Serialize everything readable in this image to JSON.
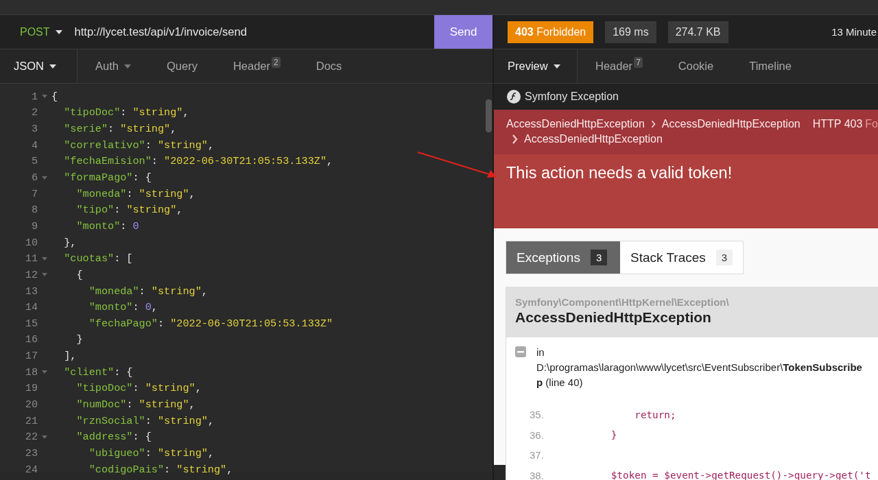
{
  "request": {
    "method": "POST",
    "url": "http://lycet.test/api/v1/invoice/send",
    "send_label": "Send"
  },
  "request_tabs": [
    {
      "label": "JSON",
      "dropdown": true,
      "selected": true
    },
    {
      "label": "Auth",
      "dropdown": true,
      "selected": false
    },
    {
      "label": "Query",
      "dropdown": false,
      "selected": false
    },
    {
      "label": "Header",
      "count": "2",
      "dropdown": false,
      "selected": false
    },
    {
      "label": "Docs",
      "dropdown": false,
      "selected": false
    }
  ],
  "editor": {
    "lines": [
      {
        "number": "1",
        "foldable": true,
        "tokens": [
          {
            "kind": "punct",
            "text": "{"
          }
        ]
      },
      {
        "number": "2",
        "foldable": false,
        "tokens": [
          {
            "kind": "key",
            "text": "  \"tipoDoc\""
          },
          {
            "kind": "punct",
            "text": ": "
          },
          {
            "kind": "str",
            "text": "\"string\""
          },
          {
            "kind": "punct",
            "text": ","
          }
        ]
      },
      {
        "number": "3",
        "foldable": false,
        "tokens": [
          {
            "kind": "key",
            "text": "  \"serie\""
          },
          {
            "kind": "punct",
            "text": ": "
          },
          {
            "kind": "str",
            "text": "\"string\""
          },
          {
            "kind": "punct",
            "text": ","
          }
        ]
      },
      {
        "number": "4",
        "foldable": false,
        "tokens": [
          {
            "kind": "key",
            "text": "  \"correlativo\""
          },
          {
            "kind": "punct",
            "text": ": "
          },
          {
            "kind": "str",
            "text": "\"string\""
          },
          {
            "kind": "punct",
            "text": ","
          }
        ]
      },
      {
        "number": "5",
        "foldable": false,
        "tokens": [
          {
            "kind": "key",
            "text": "  \"fechaEmision\""
          },
          {
            "kind": "punct",
            "text": ": "
          },
          {
            "kind": "str",
            "text": "\"2022-06-30T21:05:53.133Z\""
          },
          {
            "kind": "punct",
            "text": ","
          }
        ]
      },
      {
        "number": "6",
        "foldable": true,
        "tokens": [
          {
            "kind": "key",
            "text": "  \"formaPago\""
          },
          {
            "kind": "punct",
            "text": ": {"
          }
        ]
      },
      {
        "number": "7",
        "foldable": false,
        "tokens": [
          {
            "kind": "key",
            "text": "    \"moneda\""
          },
          {
            "kind": "punct",
            "text": ": "
          },
          {
            "kind": "str",
            "text": "\"string\""
          },
          {
            "kind": "punct",
            "text": ","
          }
        ]
      },
      {
        "number": "8",
        "foldable": false,
        "tokens": [
          {
            "kind": "key",
            "text": "    \"tipo\""
          },
          {
            "kind": "punct",
            "text": ": "
          },
          {
            "kind": "str",
            "text": "\"string\""
          },
          {
            "kind": "punct",
            "text": ","
          }
        ]
      },
      {
        "number": "9",
        "foldable": false,
        "tokens": [
          {
            "kind": "key",
            "text": "    \"monto\""
          },
          {
            "kind": "punct",
            "text": ": "
          },
          {
            "kind": "num",
            "text": "0"
          }
        ]
      },
      {
        "number": "10",
        "foldable": false,
        "tokens": [
          {
            "kind": "punct",
            "text": "  },"
          }
        ]
      },
      {
        "number": "11",
        "foldable": true,
        "tokens": [
          {
            "kind": "key",
            "text": "  \"cuotas\""
          },
          {
            "kind": "punct",
            "text": ": ["
          }
        ]
      },
      {
        "number": "12",
        "foldable": true,
        "tokens": [
          {
            "kind": "punct",
            "text": "    {"
          }
        ]
      },
      {
        "number": "13",
        "foldable": false,
        "tokens": [
          {
            "kind": "key",
            "text": "      \"moneda\""
          },
          {
            "kind": "punct",
            "text": ": "
          },
          {
            "kind": "str",
            "text": "\"string\""
          },
          {
            "kind": "punct",
            "text": ","
          }
        ]
      },
      {
        "number": "14",
        "foldable": false,
        "tokens": [
          {
            "kind": "key",
            "text": "      \"monto\""
          },
          {
            "kind": "punct",
            "text": ": "
          },
          {
            "kind": "num",
            "text": "0"
          },
          {
            "kind": "punct",
            "text": ","
          }
        ]
      },
      {
        "number": "15",
        "foldable": false,
        "tokens": [
          {
            "kind": "key",
            "text": "      \"fechaPago\""
          },
          {
            "kind": "punct",
            "text": ": "
          },
          {
            "kind": "str",
            "text": "\"2022-06-30T21:05:53.133Z\""
          }
        ]
      },
      {
        "number": "16",
        "foldable": false,
        "tokens": [
          {
            "kind": "punct",
            "text": "    }"
          }
        ]
      },
      {
        "number": "17",
        "foldable": false,
        "tokens": [
          {
            "kind": "punct",
            "text": "  ],"
          }
        ]
      },
      {
        "number": "18",
        "foldable": true,
        "tokens": [
          {
            "kind": "key",
            "text": "  \"client\""
          },
          {
            "kind": "punct",
            "text": ": {"
          }
        ]
      },
      {
        "number": "19",
        "foldable": false,
        "tokens": [
          {
            "kind": "key",
            "text": "    \"tipoDoc\""
          },
          {
            "kind": "punct",
            "text": ": "
          },
          {
            "kind": "str",
            "text": "\"string\""
          },
          {
            "kind": "punct",
            "text": ","
          }
        ]
      },
      {
        "number": "20",
        "foldable": false,
        "tokens": [
          {
            "kind": "key",
            "text": "    \"numDoc\""
          },
          {
            "kind": "punct",
            "text": ": "
          },
          {
            "kind": "str",
            "text": "\"string\""
          },
          {
            "kind": "punct",
            "text": ","
          }
        ]
      },
      {
        "number": "21",
        "foldable": false,
        "tokens": [
          {
            "kind": "key",
            "text": "    \"rznSocial\""
          },
          {
            "kind": "punct",
            "text": ": "
          },
          {
            "kind": "str",
            "text": "\"string\""
          },
          {
            "kind": "punct",
            "text": ","
          }
        ]
      },
      {
        "number": "22",
        "foldable": true,
        "tokens": [
          {
            "kind": "key",
            "text": "    \"address\""
          },
          {
            "kind": "punct",
            "text": ": {"
          }
        ]
      },
      {
        "number": "23",
        "foldable": false,
        "tokens": [
          {
            "kind": "key",
            "text": "      \"ubigueo\""
          },
          {
            "kind": "punct",
            "text": ": "
          },
          {
            "kind": "str",
            "text": "\"string\""
          },
          {
            "kind": "punct",
            "text": ","
          }
        ]
      },
      {
        "number": "24",
        "foldable": false,
        "tokens": [
          {
            "kind": "key",
            "text": "      \"codigoPais\""
          },
          {
            "kind": "punct",
            "text": ": "
          },
          {
            "kind": "str",
            "text": "\"string\""
          },
          {
            "kind": "punct",
            "text": ","
          }
        ]
      }
    ]
  },
  "response": {
    "status": "**403** Forbidden",
    "time": "169 ms",
    "size": "274.7 KB",
    "age": "13 Minute"
  },
  "response_tabs": [
    {
      "label": "Preview",
      "dropdown": true,
      "selected": true
    },
    {
      "label": "Header",
      "count": "7",
      "dropdown": false,
      "selected": false
    },
    {
      "label": "Cookie",
      "dropdown": false,
      "selected": false
    },
    {
      "label": "Timeline",
      "dropdown": false,
      "selected": false
    }
  ],
  "preview": {
    "header_title": "Symfony Exception",
    "breadcrumbs": [
      "AccessDeniedHttpException",
      "AccessDeniedHttpException",
      "AccessDeniedHttpException"
    ],
    "http_code": "HTTP 403",
    "http_status": "Fo",
    "message": "This action needs a valid token!",
    "tabs": [
      {
        "label": "Exceptions",
        "count": "3",
        "selected": true
      },
      {
        "label": "Stack Traces",
        "count": "3",
        "selected": false
      }
    ],
    "exception": {
      "namespace": "Symfony\\Component\\HttpKernel\\Exception\\",
      "class": "AccessDeniedHttpException",
      "location": [
        "in",
        "D:\\programas\\laragon\\www\\lycet\\src\\EventSubscriber\\**TokenSubscribe**",
        "**p** (line 40)"
      ],
      "code": [
        {
          "number": "35.",
          "text": "            return;"
        },
        {
          "number": "36.",
          "text": "        }"
        },
        {
          "number": "37."
        },
        {
          "number": "38.",
          "text": "        $token = $event->getRequest()->query->get('t"
        }
      ]
    }
  },
  "annotations": [
    {
      "kind": "arrow"
    }
  ]
}
